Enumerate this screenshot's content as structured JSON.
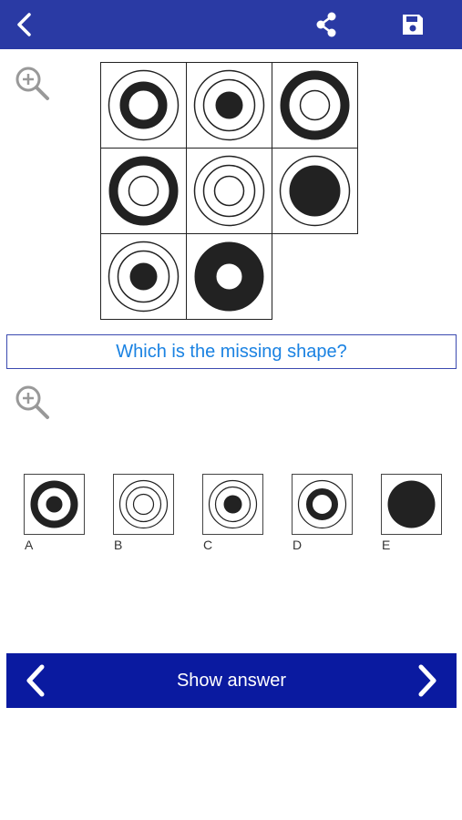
{
  "toolbar": {
    "back_icon": "chevron-left-icon",
    "share_icon": "share-icon",
    "save_icon": "floppy-disk-icon"
  },
  "question": {
    "text": "Which is the missing shape?"
  },
  "options": {
    "labels": [
      "A",
      "B",
      "C",
      "D",
      "E"
    ]
  },
  "footer": {
    "show_answer": "Show answer",
    "prev_icon": "chevron-left-icon",
    "next_icon": "chevron-right-icon"
  },
  "colors": {
    "topbar": "#2a3aa4",
    "bottombar": "#0a1aa0",
    "question_text": "#1a82e2",
    "question_border": "#3b4ab0",
    "shape": "#222222"
  }
}
